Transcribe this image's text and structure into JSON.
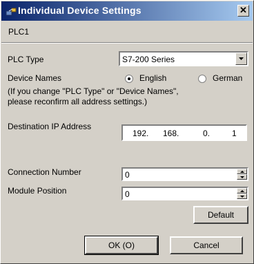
{
  "window": {
    "title": "Individual Device Settings",
    "close_glyph": "✕"
  },
  "subheader": {
    "device": "PLC1"
  },
  "plc_type": {
    "label": "PLC Type",
    "selected": "S7-200 Series"
  },
  "device_names": {
    "label": "Device Names",
    "options": [
      {
        "label": "English",
        "selected": true
      },
      {
        "label": "German",
        "selected": false
      }
    ]
  },
  "notice": {
    "line1": "(If you change \"PLC Type\" or \"Device Names\",",
    "line2": "please reconfirm all address settings.)"
  },
  "destination_ip": {
    "label": "Destination IP Address",
    "octets": [
      "192.",
      "168.",
      "0.",
      "1"
    ]
  },
  "connection_number": {
    "label": "Connection Number",
    "value": "0"
  },
  "module_position": {
    "label": "Module Position",
    "value": "0"
  },
  "buttons": {
    "default": "Default",
    "ok": "OK (O)",
    "cancel": "Cancel"
  },
  "icons": {
    "app": "network-device-icon",
    "close": "close-icon"
  }
}
